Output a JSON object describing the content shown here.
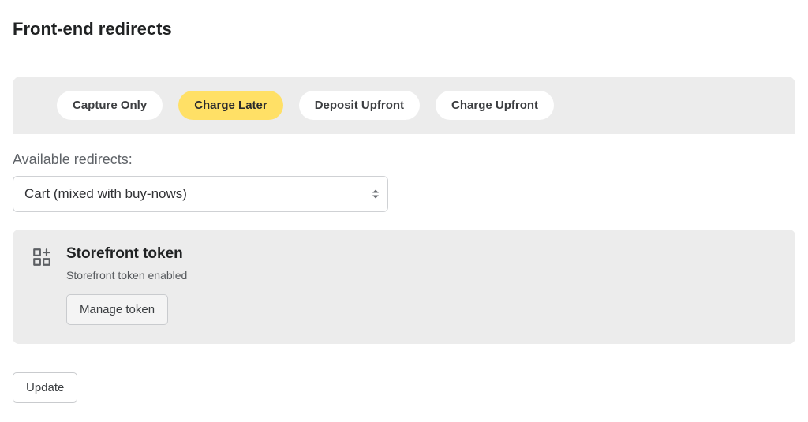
{
  "header": {
    "title": "Front-end redirects"
  },
  "tabs": {
    "items": [
      {
        "label": "Capture Only",
        "active": false
      },
      {
        "label": "Charge Later",
        "active": true
      },
      {
        "label": "Deposit Upfront",
        "active": false
      },
      {
        "label": "Charge Upfront",
        "active": false
      }
    ]
  },
  "redirects": {
    "label": "Available redirects:",
    "selected": "Cart (mixed with buy-nows)"
  },
  "storefront": {
    "title": "Storefront token",
    "subtitle": "Storefront token enabled",
    "manage_label": "Manage token"
  },
  "actions": {
    "update_label": "Update"
  }
}
